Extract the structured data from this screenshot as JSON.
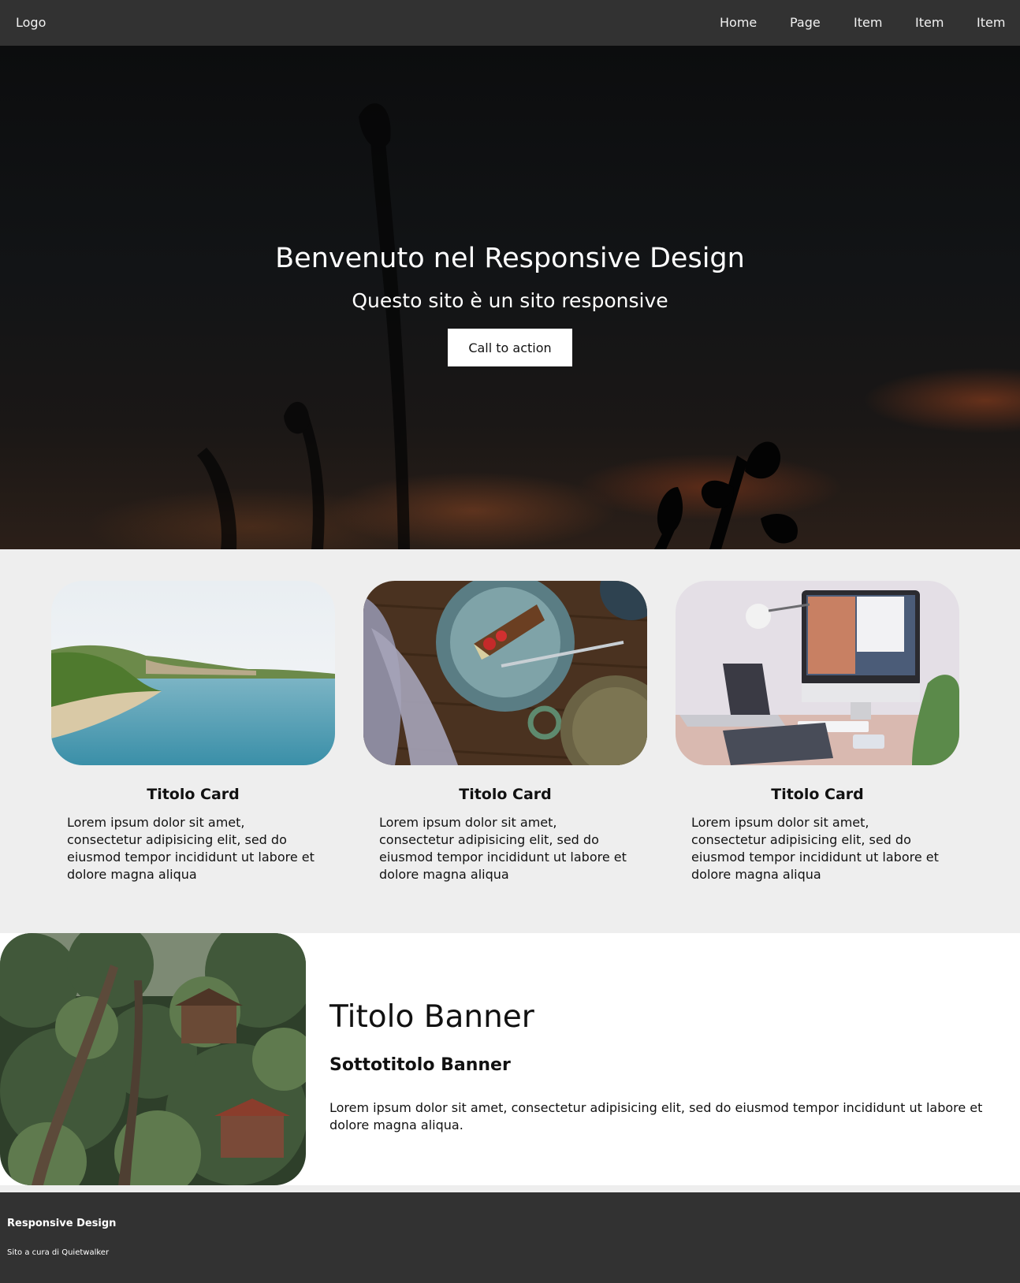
{
  "nav": {
    "logo": "Logo",
    "items": [
      "Home",
      "Page",
      "Item",
      "Item",
      "Item"
    ]
  },
  "hero": {
    "title": "Benvenuto nel Responsive Design",
    "subtitle": "Questo sito è un sito responsive",
    "cta": "Call to action"
  },
  "cards": [
    {
      "image": "coastline-photo",
      "title": "Titolo Card",
      "text": "Lorem ipsum dolor sit amet, consectetur adipisicing elit, sed do eiusmod tempor incididunt ut labore et dolore magna aliqua"
    },
    {
      "image": "dessert-plate-photo",
      "title": "Titolo Card",
      "text": "Lorem ipsum dolor sit amet, consectetur adipisicing elit, sed do eiusmod tempor incididunt ut labore et dolore magna aliqua"
    },
    {
      "image": "desk-computer-photo",
      "title": "Titolo Card",
      "text": "Lorem ipsum dolor sit amet, consectetur adipisicing elit, sed do eiusmod tempor incididunt ut labore et dolore magna aliqua"
    }
  ],
  "banner": {
    "image": "jungle-house-photo",
    "title": "Titolo Banner",
    "subtitle": "Sottotitolo Banner",
    "text": "Lorem ipsum dolor sit amet, consectetur adipisicing elit, sed do eiusmod tempor incididunt ut labore et dolore magna aliqua."
  },
  "footer": {
    "title": "Responsive Design",
    "credit": "Sito a cura di Quietwalker"
  },
  "colors": {
    "nav_bg": "#323232",
    "page_bg": "#eeeeee",
    "button_bg": "#ffffff",
    "text_dark": "#111111"
  }
}
